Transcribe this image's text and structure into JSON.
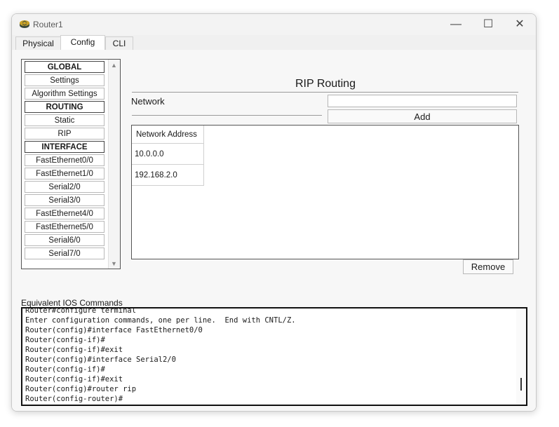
{
  "window": {
    "title": "Router1",
    "icon": "router-icon"
  },
  "controls": {
    "minimize": "—",
    "maximize": "☐",
    "close": "✕"
  },
  "tabs": [
    {
      "label": "Physical"
    },
    {
      "label": "Config",
      "active": true
    },
    {
      "label": "CLI"
    }
  ],
  "nav": {
    "global_header": "GLOBAL",
    "settings": "Settings",
    "algorithm_settings": "Algorithm Settings",
    "routing_header": "ROUTING",
    "static": "Static",
    "rip": "RIP",
    "interface_header": "INTERFACE",
    "interfaces": [
      "FastEthernet0/0",
      "FastEthernet1/0",
      "Serial2/0",
      "Serial3/0",
      "FastEthernet4/0",
      "FastEthernet5/0",
      "Serial6/0",
      "Serial7/0"
    ]
  },
  "rip": {
    "title": "RIP Routing",
    "network_label": "Network",
    "network_value": "",
    "add_label": "Add",
    "table_header": "Network Address",
    "networks": [
      "10.0.0.0",
      "192.168.2.0"
    ],
    "remove_label": "Remove"
  },
  "ios": {
    "label": "Equivalent IOS Commands",
    "lines": [
      "Router#configure terminal",
      "Enter configuration commands, one per line.  End with CNTL/Z.",
      "Router(config)#interface FastEthernet0/0",
      "Router(config-if)#",
      "Router(config-if)#exit",
      "Router(config)#interface Serial2/0",
      "Router(config-if)#",
      "Router(config-if)#exit",
      "Router(config)#router rip",
      "Router(config-router)#"
    ]
  }
}
